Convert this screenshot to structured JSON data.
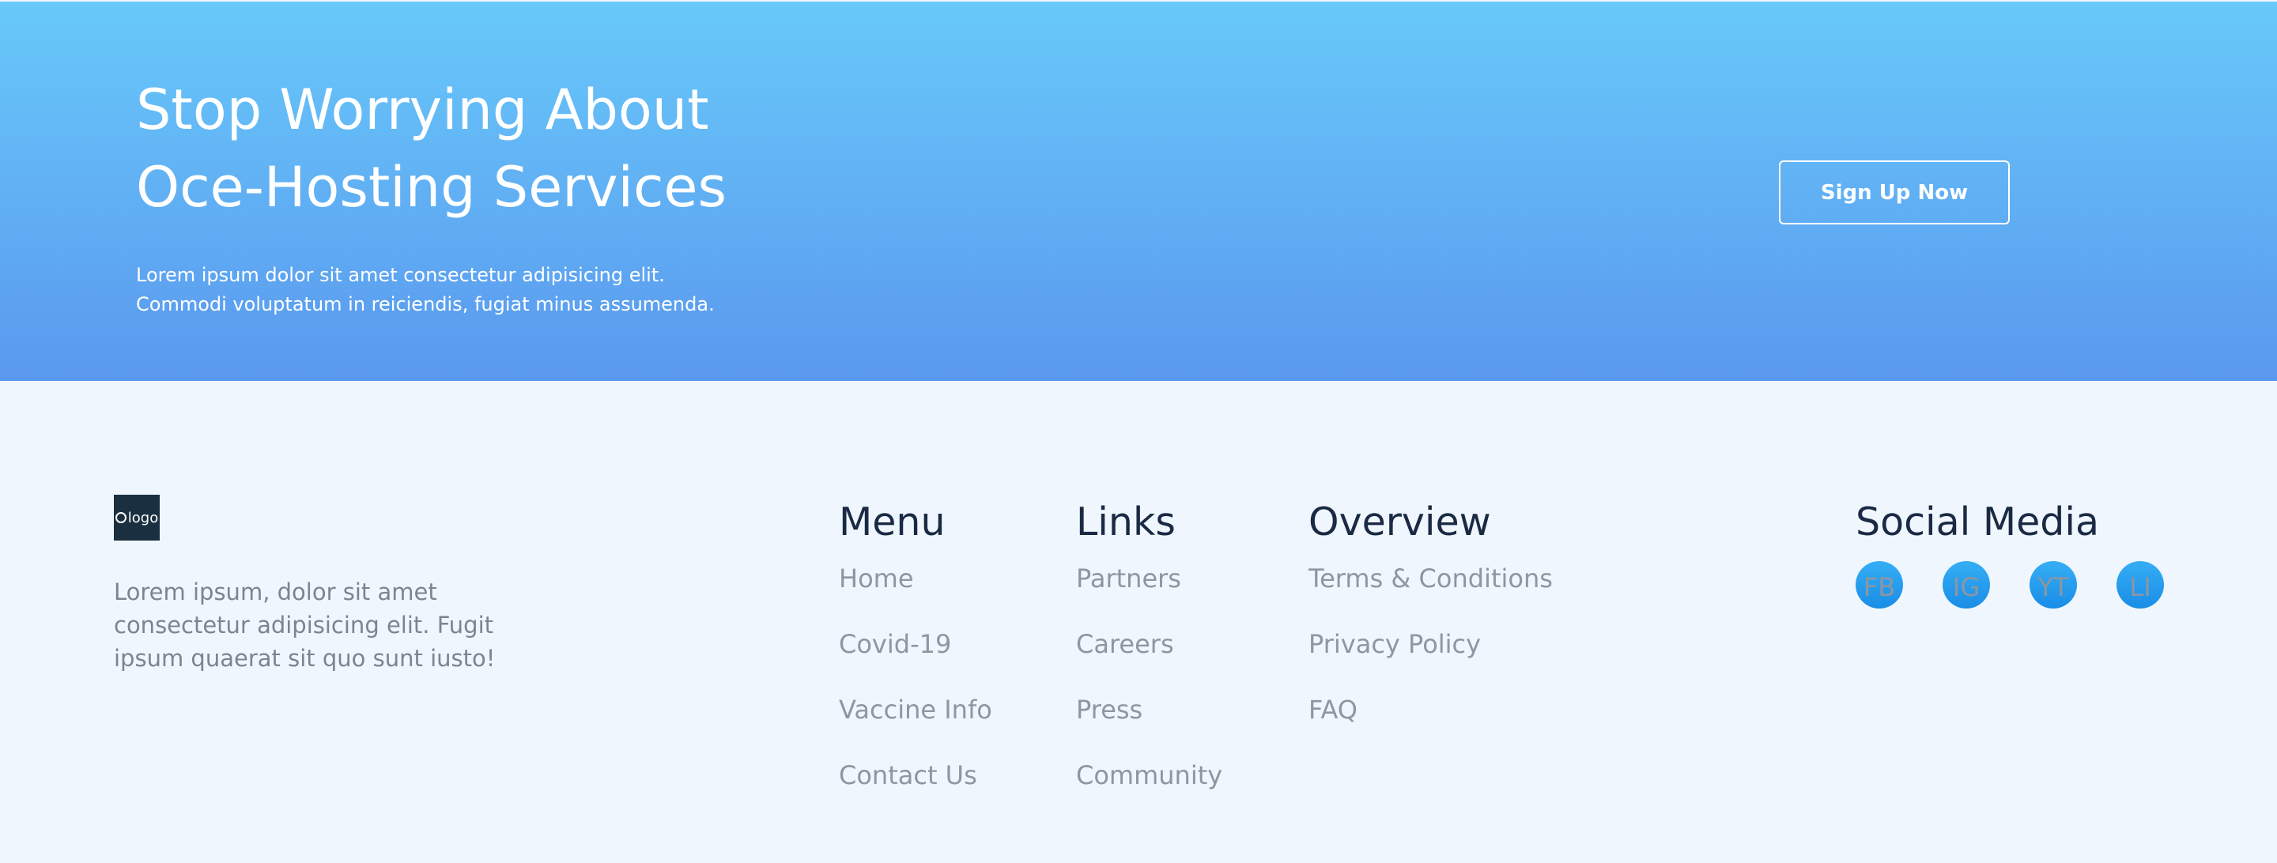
{
  "cta": {
    "title_line1": "Stop Worrying About",
    "title_line2": "Oce-Hosting Services",
    "text": "Lorem ipsum dolor sit amet consectetur adipisicing elit. Commodi voluptatum in reiciendis, fugiat minus assumenda.",
    "button_label": "Sign Up Now",
    "gradient_top": "#68c9fa",
    "gradient_bottom": "#5a98ee"
  },
  "footer": {
    "logo_text": "logo",
    "brand_text": "Lorem ipsum, dolor sit amet consectetur adipisicing elit. Fugit ipsum quaerat sit quo sunt iusto!",
    "menu": {
      "title": "Menu",
      "items": [
        "Home",
        "Covid-19",
        "Vaccine Info",
        "Contact Us"
      ]
    },
    "links": {
      "title": "Links",
      "items": [
        "Partners",
        "Careers",
        "Press",
        "Community"
      ]
    },
    "overview": {
      "title": "Overview",
      "items": [
        "Terms & Conditions",
        "Privacy Policy",
        "FAQ"
      ]
    },
    "social": {
      "title": "Social Media",
      "items": [
        "FB",
        "IG",
        "YT",
        "LI"
      ],
      "accent": "#1a8de6"
    }
  }
}
